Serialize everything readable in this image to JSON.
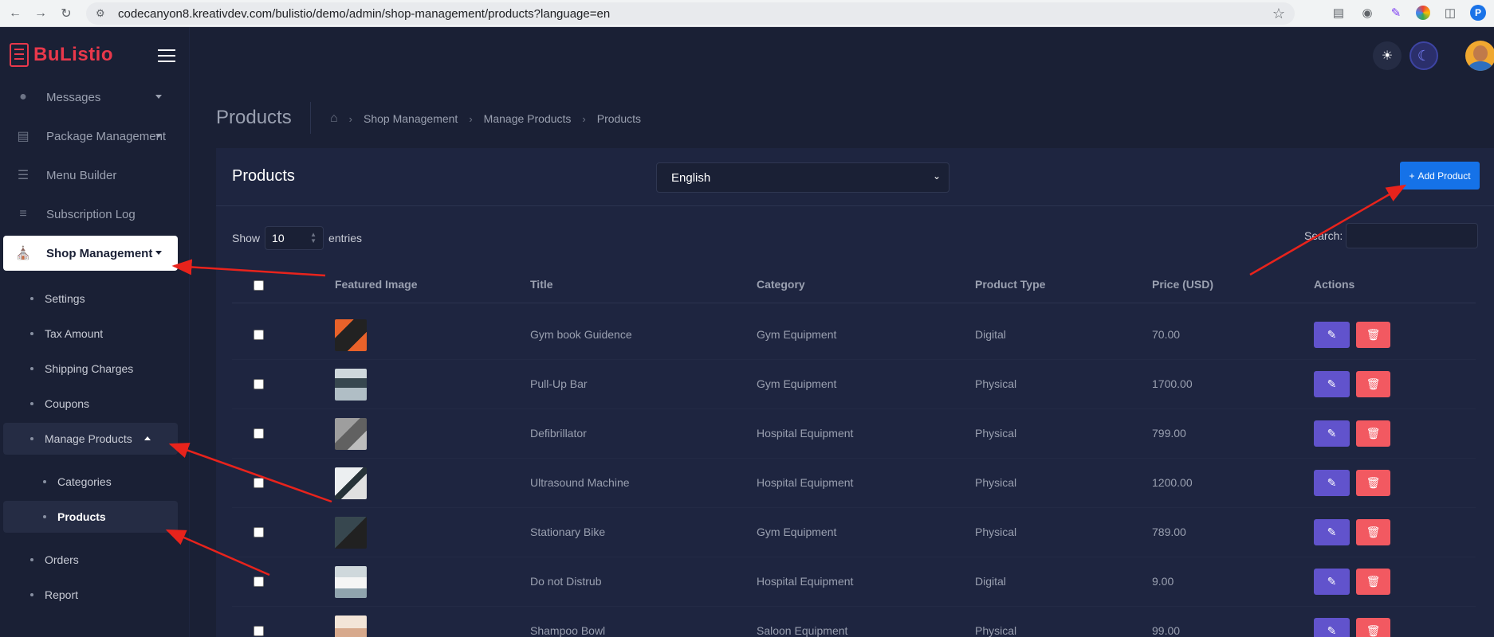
{
  "browser": {
    "url": "codecanyon8.kreativdev.com/bulistio/demo/admin/shop-management/products?language=en",
    "profile_initial": "P"
  },
  "brand": {
    "name": "BuListio",
    "color": "#e9384b"
  },
  "sidebar": {
    "items": [
      {
        "label": "Messages",
        "icon": "chat-bubble-icon"
      },
      {
        "label": "Package Management",
        "icon": "receipt-icon"
      },
      {
        "label": "Menu Builder",
        "icon": "bars-icon"
      },
      {
        "label": "Subscription Log",
        "icon": "list-icon"
      },
      {
        "label": "Shop Management",
        "icon": "store-icon"
      }
    ],
    "shop_sub": [
      "Settings",
      "Tax Amount",
      "Shipping Charges",
      "Coupons",
      "Manage Products"
    ],
    "manage_products_sub": [
      "Categories",
      "Products"
    ],
    "after": [
      "Orders",
      "Report"
    ]
  },
  "page": {
    "title": "Products",
    "breadcrumb": [
      "Shop Management",
      "Manage Products",
      "Products"
    ]
  },
  "card": {
    "title": "Products",
    "language_selected": "English",
    "add_button": "Add Product",
    "show_label": "Show",
    "entries_value": "10",
    "entries_label": "entries",
    "search_label": "Search:"
  },
  "table": {
    "columns": [
      "Featured Image",
      "Title",
      "Category",
      "Product Type",
      "Price (USD)",
      "Actions"
    ],
    "rows": [
      {
        "title": "Gym book Guidence",
        "category": "Gym Equipment",
        "type": "Digital",
        "price": "70.00"
      },
      {
        "title": "Pull-Up Bar",
        "category": "Gym Equipment",
        "type": "Physical",
        "price": "1700.00"
      },
      {
        "title": "Defibrillator",
        "category": "Hospital Equipment",
        "type": "Physical",
        "price": "799.00"
      },
      {
        "title": "Ultrasound Machine",
        "category": "Hospital Equipment",
        "type": "Physical",
        "price": "1200.00"
      },
      {
        "title": "Stationary Bike",
        "category": "Gym Equipment",
        "type": "Physical",
        "price": "789.00"
      },
      {
        "title": "Do not Distrub",
        "category": "Hospital Equipment",
        "type": "Digital",
        "price": "9.00"
      },
      {
        "title": "Shampoo Bowl",
        "category": "Saloon Equipment",
        "type": "Physical",
        "price": "99.00"
      }
    ]
  },
  "colors": {
    "accent_blue": "#1572e8",
    "edit_purple": "#6153cc",
    "delete_red": "#f25961",
    "annotation_red": "#e8231c"
  }
}
